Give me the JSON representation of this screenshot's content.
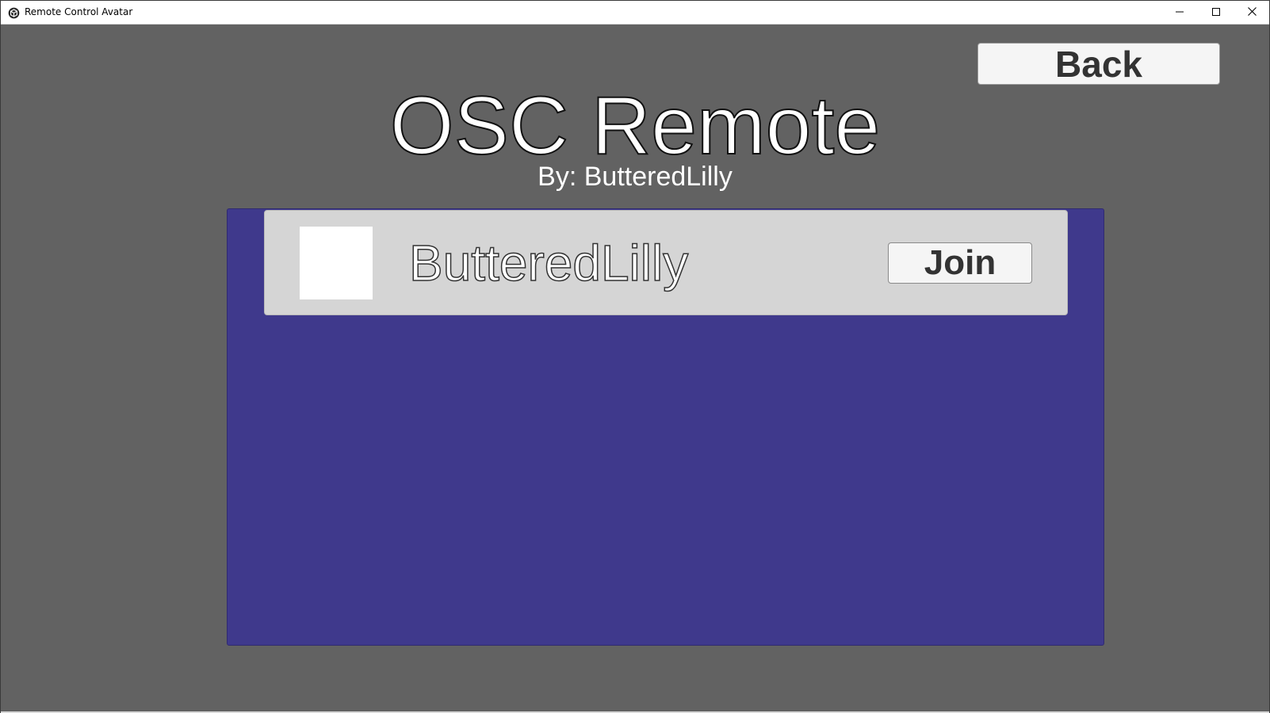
{
  "window": {
    "title": "Remote Control Avatar",
    "app_icon": "unity-cube-icon",
    "controls": {
      "minimize_icon": "minimize-icon",
      "maximize_icon": "maximize-icon",
      "close_icon": "close-icon"
    }
  },
  "header": {
    "back_label": "Back",
    "title": "OSC Remote",
    "subtitle": "By: ButteredLilly"
  },
  "sessions": [
    {
      "host": "ButteredLilly",
      "join_label": "Join"
    }
  ],
  "colors": {
    "background": "#626262",
    "panel": "#3f398c",
    "row": "#d5d5d5",
    "button": "#f5f5f5"
  }
}
